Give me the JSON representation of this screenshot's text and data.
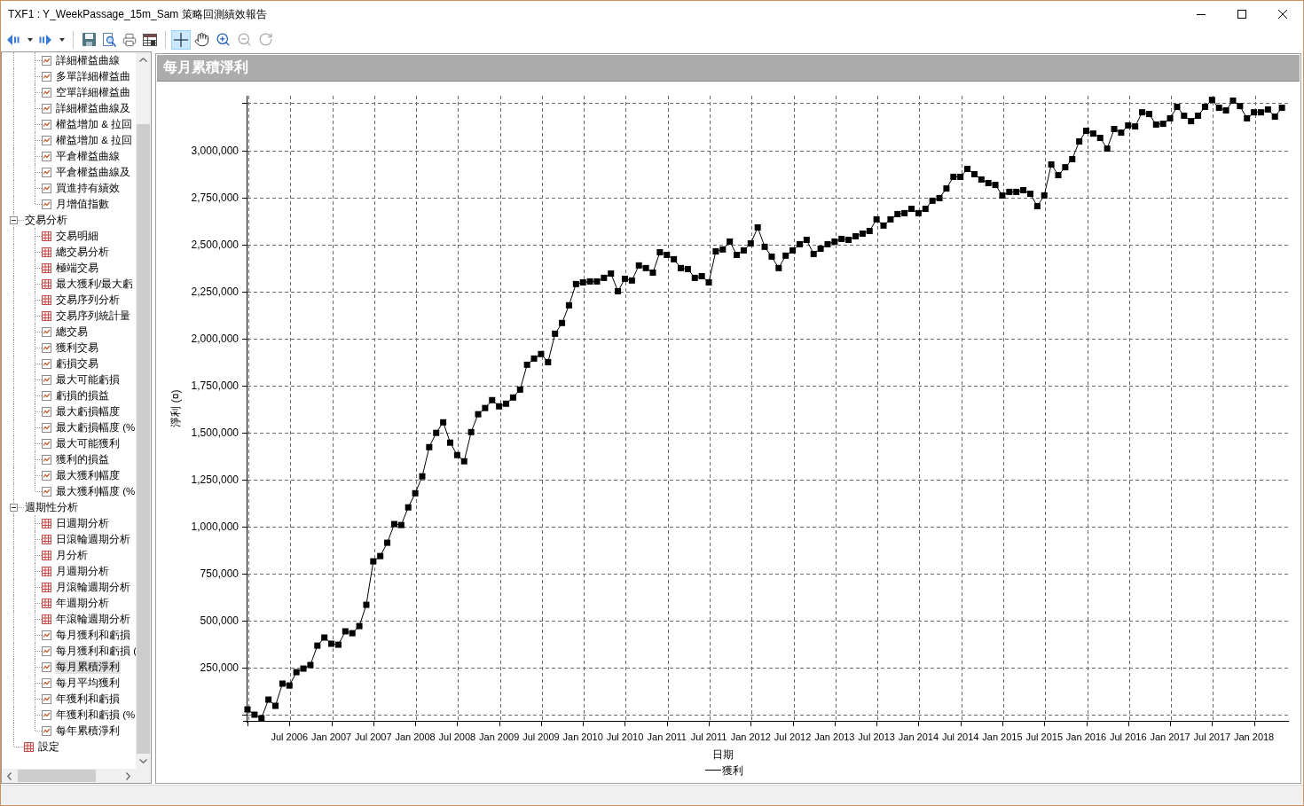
{
  "window": {
    "title": "TXF1 : Y_WeekPassage_15m_Sam 策略回測績效報告"
  },
  "toolbar": {
    "tools": [
      {
        "kind": "back",
        "dropdown": true,
        "disabled": false
      },
      {
        "kind": "forward",
        "dropdown": true,
        "disabled": false
      },
      {
        "kind": "separator"
      },
      {
        "kind": "save",
        "disabled": false
      },
      {
        "kind": "print-preview",
        "disabled": false
      },
      {
        "kind": "print",
        "disabled": false
      },
      {
        "kind": "table",
        "disabled": false
      },
      {
        "kind": "separator"
      },
      {
        "kind": "crosshair",
        "selected": true,
        "disabled": false
      },
      {
        "kind": "pan",
        "selected": false,
        "disabled": false
      },
      {
        "kind": "zoom-in",
        "selected": false,
        "disabled": false
      },
      {
        "kind": "zoom-out",
        "selected": false,
        "disabled": true
      },
      {
        "kind": "reset",
        "selected": false,
        "disabled": true
      }
    ]
  },
  "sidebar": {
    "tree": [
      {
        "children": [
          {
            "label": "詳細權益曲線",
            "kind": "chart",
            "selected": false
          },
          {
            "label": "多單詳細權益曲",
            "kind": "chart",
            "selected": false
          },
          {
            "label": "空單詳細權益曲",
            "kind": "chart",
            "selected": false
          },
          {
            "label": "詳細權益曲線及",
            "kind": "chart",
            "selected": false
          },
          {
            "label": "權益增加 & 拉回",
            "kind": "chart",
            "selected": false
          },
          {
            "label": "權益增加 & 拉回",
            "kind": "chart",
            "selected": false
          },
          {
            "label": "平倉權益曲線",
            "kind": "chart",
            "selected": false
          },
          {
            "label": "平倉權益曲線及",
            "kind": "chart",
            "selected": false
          },
          {
            "label": "買進持有績效",
            "kind": "chart",
            "selected": false
          },
          {
            "label": "月增值指數",
            "kind": "chart",
            "selected": false
          }
        ]
      },
      {
        "label": "交易分析",
        "expanded": true,
        "selected": false,
        "children": [
          {
            "label": "交易明細",
            "kind": "table",
            "selected": false
          },
          {
            "label": "總交易分析",
            "kind": "table",
            "selected": false
          },
          {
            "label": "極端交易",
            "kind": "table",
            "selected": false
          },
          {
            "label": "最大獲利/最大虧",
            "kind": "table",
            "selected": false
          },
          {
            "label": "交易序列分析",
            "kind": "table",
            "selected": false
          },
          {
            "label": "交易序列統計量",
            "kind": "table",
            "selected": false
          },
          {
            "label": "總交易",
            "kind": "chart",
            "selected": false
          },
          {
            "label": "獲利交易",
            "kind": "chart",
            "selected": false
          },
          {
            "label": "虧損交易",
            "kind": "chart",
            "selected": false
          },
          {
            "label": "最大可能虧損",
            "kind": "chart",
            "selected": false
          },
          {
            "label": "虧損的損益",
            "kind": "chart",
            "selected": false
          },
          {
            "label": "最大虧損幅度",
            "kind": "chart",
            "selected": false
          },
          {
            "label": "最大虧損幅度 (%",
            "kind": "chart",
            "selected": false
          },
          {
            "label": "最大可能獲利",
            "kind": "chart",
            "selected": false
          },
          {
            "label": "獲利的損益",
            "kind": "chart",
            "selected": false
          },
          {
            "label": "最大獲利幅度",
            "kind": "chart",
            "selected": false
          },
          {
            "label": "最大獲利幅度 (%",
            "kind": "chart",
            "selected": false
          }
        ]
      },
      {
        "label": "週期性分析",
        "expanded": true,
        "selected": false,
        "children": [
          {
            "label": "日週期分析",
            "kind": "table",
            "selected": false
          },
          {
            "label": "日滾輪週期分析",
            "kind": "table",
            "selected": false
          },
          {
            "label": "月分析",
            "kind": "table",
            "selected": false
          },
          {
            "label": "月週期分析",
            "kind": "table",
            "selected": false
          },
          {
            "label": "月滾輪週期分析",
            "kind": "table",
            "selected": false
          },
          {
            "label": "年週期分析",
            "kind": "table",
            "selected": false
          },
          {
            "label": "年滾輪週期分析",
            "kind": "table",
            "selected": false
          },
          {
            "label": "每月獲利和虧損",
            "kind": "chart",
            "selected": false
          },
          {
            "label": "每月獲利和虧損 (",
            "kind": "chart",
            "selected": false
          },
          {
            "label": "每月累積淨利",
            "kind": "chart",
            "selected": true
          },
          {
            "label": "每月平均獲利",
            "kind": "chart",
            "selected": false
          },
          {
            "label": "年獲利和虧損",
            "kind": "chart",
            "selected": false
          },
          {
            "label": "年獲利和虧損 (%",
            "kind": "chart",
            "selected": false
          },
          {
            "label": "每年累積淨利",
            "kind": "chart",
            "selected": false
          }
        ]
      },
      {
        "label": "設定",
        "kind": "table",
        "selected": false
      }
    ]
  },
  "chart_panel": {
    "title": "每月累積淨利",
    "chart_data": {
      "type": "line",
      "xlabel": "日期",
      "ylabel": "淨利 (¤)",
      "grid": true,
      "categories": [
        null,
        null,
        null,
        null,
        null,
        null,
        "Jul 2006",
        null,
        null,
        null,
        null,
        null,
        "Jan 2007",
        null,
        null,
        null,
        null,
        null,
        "Jul 2007",
        null,
        null,
        null,
        null,
        null,
        "Jan 2008",
        null,
        null,
        null,
        null,
        null,
        "Jul 2008",
        null,
        null,
        null,
        null,
        null,
        "Jan 2009",
        null,
        null,
        null,
        null,
        null,
        "Jul 2009",
        null,
        null,
        null,
        null,
        null,
        "Jan 2010",
        null,
        null,
        null,
        null,
        null,
        "Jul 2010",
        null,
        null,
        null,
        null,
        null,
        "Jan 2011",
        null,
        null,
        null,
        null,
        null,
        "Jul 2011",
        null,
        null,
        null,
        null,
        null,
        "Jan 2012",
        null,
        null,
        null,
        null,
        null,
        "Jul 2012",
        null,
        null,
        null,
        null,
        null,
        "Jan 2013",
        null,
        null,
        null,
        null,
        null,
        "Jul 2013",
        null,
        null,
        null,
        null,
        null,
        "Jan 2014",
        null,
        null,
        null,
        null,
        null,
        "Jul 2014",
        null,
        null,
        null,
        null,
        null,
        "Jan 2015",
        null,
        null,
        null,
        null,
        null,
        "Jul 2015",
        null,
        null,
        null,
        null,
        null,
        "Jan 2016",
        null,
        null,
        null,
        null,
        null,
        "Jul 2016",
        null,
        null,
        null,
        null,
        null,
        "Jan 2017",
        null,
        null,
        null,
        null,
        null,
        "Jul 2017",
        null,
        null,
        null,
        null,
        null,
        "Jan 2018",
        null,
        null,
        null,
        null
      ],
      "ylim": [
        -33000,
        3290000
      ],
      "yticks": [
        {
          "value": 250000,
          "label": "250,000"
        },
        {
          "value": 500000,
          "label": "500,000"
        },
        {
          "value": 750000,
          "label": "750,000"
        },
        {
          "value": 1000000,
          "label": "1,000,000"
        },
        {
          "value": 1250000,
          "label": "1,250,000"
        },
        {
          "value": 1500000,
          "label": "1,500,000"
        },
        {
          "value": 1750000,
          "label": "1,750,000"
        },
        {
          "value": 2000000,
          "label": "2,000,000"
        },
        {
          "value": 2250000,
          "label": "2,250,000"
        },
        {
          "value": 2500000,
          "label": "2,500,000"
        },
        {
          "value": 2750000,
          "label": "2,750,000"
        },
        {
          "value": 3000000,
          "label": "3,000,000"
        }
      ],
      "series": [
        {
          "name": "獲利",
          "color": "#000000",
          "marker": "square",
          "values": [
            28000,
            0,
            -19000,
            80000,
            47000,
            165000,
            155000,
            226000,
            245000,
            264000,
            367000,
            410000,
            377000,
            372000,
            443000,
            433000,
            471000,
            584000,
            815000,
            843000,
            914000,
            1013000,
            1008000,
            1102000,
            1177000,
            1267000,
            1422000,
            1498000,
            1554000,
            1446000,
            1380000,
            1347000,
            1502000,
            1597000,
            1630000,
            1672000,
            1639000,
            1653000,
            1686000,
            1728000,
            1860000,
            1893000,
            1917000,
            1874000,
            2025000,
            2082000,
            2176000,
            2289000,
            2298000,
            2303000,
            2303000,
            2322000,
            2345000,
            2251000,
            2317000,
            2308000,
            2388000,
            2374000,
            2350000,
            2458000,
            2444000,
            2421000,
            2374000,
            2369000,
            2322000,
            2331000,
            2298000,
            2463000,
            2473000,
            2515000,
            2444000,
            2468000,
            2505000,
            2590000,
            2487000,
            2435000,
            2374000,
            2440000,
            2468000,
            2501000,
            2524000,
            2449000,
            2477000,
            2501000,
            2515000,
            2529000,
            2524000,
            2543000,
            2557000,
            2571000,
            2633000,
            2600000,
            2633000,
            2661000,
            2666000,
            2689000,
            2666000,
            2689000,
            2732000,
            2746000,
            2797000,
            2859000,
            2859000,
            2901000,
            2873000,
            2845000,
            2826000,
            2816000,
            2760000,
            2779000,
            2779000,
            2788000,
            2769000,
            2703000,
            2760000,
            2925000,
            2868000,
            2910000,
            2953000,
            3047000,
            3104000,
            3089000,
            3066000,
            3009000,
            3113000,
            3094000,
            3132000,
            3127000,
            3202000,
            3193000,
            3137000,
            3141000,
            3170000,
            3231000,
            3184000,
            3155000,
            3184000,
            3231000,
            3268000,
            3226000,
            3212000,
            3264000,
            3235000,
            3170000,
            3202000,
            3202000,
            3217000,
            3179000,
            3226000
          ]
        }
      ]
    }
  }
}
